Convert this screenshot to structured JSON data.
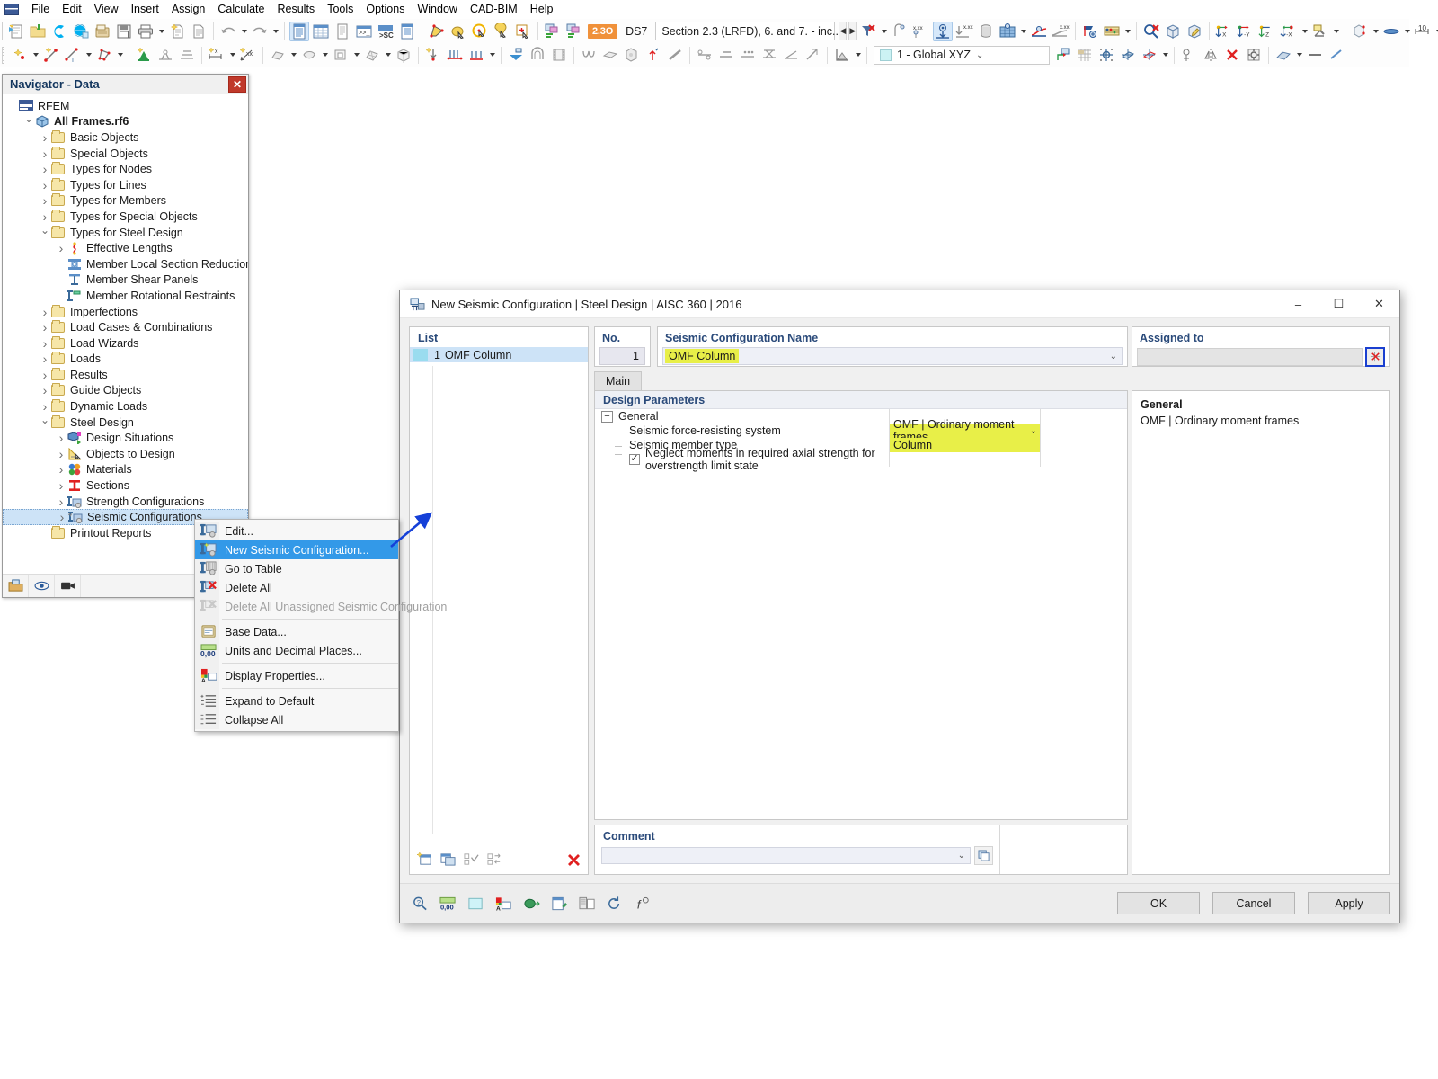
{
  "app": {
    "name": "RFEM",
    "logo_icon": "rfem-logo-icon"
  },
  "menubar": {
    "items": [
      "File",
      "Edit",
      "View",
      "Insert",
      "Assign",
      "Calculate",
      "Results",
      "Tools",
      "Options",
      "Window",
      "CAD-BIM",
      "Help"
    ]
  },
  "toolbar_top": {
    "badge": "2.3O",
    "ds_label": "DS7",
    "section_combo": "Section 2.3 (LRFD), 6. and 7. - inc...",
    "icons_group1": [
      "new-model-icon",
      "open-folder-icon",
      "connect-icon",
      "globe-icon",
      "save-as-icon",
      "save-icon",
      "print-icon",
      "new-report-icon",
      "document-icon"
    ],
    "icons_group2": [
      "undo-icon",
      "redo-icon"
    ],
    "icons_group3": [
      "table-list-icon",
      "table-grid-icon",
      "table-report-icon",
      "console-icon",
      "script-sc-icon",
      "table-blue-icon"
    ],
    "icons_group4": [
      "select-area-icon",
      "select-lasso-icon",
      "select-circle-icon",
      "select-pointer-icon",
      "select-plus-icon"
    ],
    "icons_group5": [
      "render-a-icon",
      "render-b-icon"
    ],
    "icons_group6": [
      "filter-clear-icon",
      "node-support-icon",
      "node-values-icon",
      "show-loads-icon",
      "hide-loads-icon",
      "solid-icon",
      "surface-icon",
      "deformation-icon",
      "diagram-icon",
      "result-flag-icon",
      "abacus-icon"
    ],
    "icons_group7": [
      "zoom-clear-icon",
      "cube-icon",
      "edit-cube-icon"
    ],
    "icons_group8": [
      "view-x-icon",
      "view-y-icon",
      "view-z-icon",
      "view-negx-icon",
      "perspective-icon"
    ],
    "icons_group9": [
      "box-view-icon",
      "lens-icon",
      "dim-10-icon",
      "layers-icon",
      "mesh-points-icon"
    ]
  },
  "toolbar_second": {
    "coord_system": "1 - Global XYZ",
    "icons_group1": [
      "new-node-icon",
      "new-line-icon",
      "new-line-i-icon",
      "new-polygon-icon"
    ],
    "icons_group2": [
      "new-support-icon",
      "new-hinge-icon",
      "new-release-icon"
    ],
    "icons_group3": [
      "dim-x-icon",
      "dim-xx-icon"
    ],
    "icons_group4": [
      "new-surface-icon",
      "new-solid-icon",
      "new-opening-icon",
      "new-mesh-icon",
      "new-block-icon"
    ],
    "icons_group5": [
      "new-load-icon",
      "member-load-icon",
      "line-load-icon",
      "surface-load-icon"
    ],
    "icons_group6": [
      "free-load-icon",
      "tunnel-icon",
      "film-icon"
    ],
    "icons_group7": [
      "curve-icon",
      "plate-icon",
      "box-load-icon",
      "arrow-up-icon",
      "slope-icon"
    ],
    "icons_group8": [
      "hinge-a-icon",
      "hinge-b-icon",
      "hinge-c-icon",
      "hinge-d-icon",
      "hinge-e-icon",
      "hinge-f-icon"
    ],
    "icons_group9": [
      "chart-icon"
    ],
    "icons_group10": [
      "ucs-icon",
      "grid-icon",
      "snap-icon",
      "plane-icon",
      "plane-2-icon"
    ],
    "icons_group11": [
      "guide-icon",
      "mirror-icon",
      "delete-red-icon",
      "settings-icon"
    ],
    "icons_group12": [
      "render-mode-icon",
      "line-style-icon",
      "dash-icon"
    ]
  },
  "navigator": {
    "title": "Navigator - Data",
    "close_icon": "close-icon",
    "tree": [
      {
        "label": "RFEM",
        "indent": 0,
        "chevron": "none",
        "icon": "rfem-logo-icon",
        "bold": false
      },
      {
        "label": "All Frames.rf6",
        "indent": 1,
        "chevron": "down",
        "icon": "model-icon",
        "bold": true
      },
      {
        "label": "Basic Objects",
        "indent": 2,
        "chevron": "right",
        "icon": "folder-icon",
        "bold": false
      },
      {
        "label": "Special Objects",
        "indent": 2,
        "chevron": "right",
        "icon": "folder-icon",
        "bold": false
      },
      {
        "label": "Types for Nodes",
        "indent": 2,
        "chevron": "right",
        "icon": "folder-icon",
        "bold": false
      },
      {
        "label": "Types for Lines",
        "indent": 2,
        "chevron": "right",
        "icon": "folder-icon",
        "bold": false
      },
      {
        "label": "Types for Members",
        "indent": 2,
        "chevron": "right",
        "icon": "folder-icon",
        "bold": false
      },
      {
        "label": "Types for Special Objects",
        "indent": 2,
        "chevron": "right",
        "icon": "folder-icon",
        "bold": false
      },
      {
        "label": "Types for Steel Design",
        "indent": 2,
        "chevron": "down",
        "icon": "folder-icon",
        "bold": false
      },
      {
        "label": "Effective Lengths",
        "indent": 3,
        "chevron": "right",
        "icon": "effective-lengths-icon",
        "bold": false
      },
      {
        "label": "Member Local Section Reductions",
        "indent": 3,
        "chevron": "none",
        "icon": "section-reduction-icon",
        "bold": false
      },
      {
        "label": "Member Shear Panels",
        "indent": 3,
        "chevron": "none",
        "icon": "shear-panel-icon",
        "bold": false
      },
      {
        "label": "Member Rotational Restraints",
        "indent": 3,
        "chevron": "none",
        "icon": "rotational-restraint-icon",
        "bold": false
      },
      {
        "label": "Imperfections",
        "indent": 2,
        "chevron": "right",
        "icon": "folder-icon",
        "bold": false
      },
      {
        "label": "Load Cases & Combinations",
        "indent": 2,
        "chevron": "right",
        "icon": "folder-icon",
        "bold": false
      },
      {
        "label": "Load Wizards",
        "indent": 2,
        "chevron": "right",
        "icon": "folder-icon",
        "bold": false
      },
      {
        "label": "Loads",
        "indent": 2,
        "chevron": "right",
        "icon": "folder-icon",
        "bold": false
      },
      {
        "label": "Results",
        "indent": 2,
        "chevron": "right",
        "icon": "folder-icon",
        "bold": false
      },
      {
        "label": "Guide Objects",
        "indent": 2,
        "chevron": "right",
        "icon": "folder-icon",
        "bold": false
      },
      {
        "label": "Dynamic Loads",
        "indent": 2,
        "chevron": "right",
        "icon": "folder-icon",
        "bold": false
      },
      {
        "label": "Steel Design",
        "indent": 2,
        "chevron": "down",
        "icon": "folder-icon",
        "bold": false
      },
      {
        "label": "Design Situations",
        "indent": 3,
        "chevron": "right",
        "icon": "design-situations-icon",
        "bold": false
      },
      {
        "label": "Objects to Design",
        "indent": 3,
        "chevron": "right",
        "icon": "objects-to-design-icon",
        "bold": false
      },
      {
        "label": "Materials",
        "indent": 3,
        "chevron": "right",
        "icon": "materials-icon",
        "bold": false
      },
      {
        "label": "Sections",
        "indent": 3,
        "chevron": "right",
        "icon": "sections-icon",
        "bold": false
      },
      {
        "label": "Strength Configurations",
        "indent": 3,
        "chevron": "right",
        "icon": "strength-config-icon",
        "bold": false
      },
      {
        "label": "Seismic Configurations",
        "indent": 3,
        "chevron": "right",
        "icon": "seismic-config-icon",
        "bold": false,
        "selected": true
      },
      {
        "label": "Printout Reports",
        "indent": 2,
        "chevron": "none",
        "icon": "folder-icon",
        "bold": false
      }
    ],
    "bottom_icons": [
      "open-navigator-icon",
      "visibility-eye-icon",
      "camera-icon"
    ]
  },
  "context_menu": {
    "items": [
      {
        "label": "Edit...",
        "icon": "edit-config-icon",
        "state": "normal"
      },
      {
        "label": "New Seismic Configuration...",
        "icon": "new-config-icon",
        "state": "selected"
      },
      {
        "label": "Go to Table",
        "icon": "goto-table-icon",
        "state": "normal"
      },
      {
        "label": "Delete All",
        "icon": "delete-all-icon",
        "state": "normal"
      },
      {
        "label": "Delete All Unassigned Seismic Configuration",
        "icon": "delete-unassigned-icon",
        "state": "disabled"
      },
      {
        "label": "Base Data...",
        "icon": "base-data-icon",
        "state": "normal",
        "sep_before": true
      },
      {
        "label": "Units and Decimal Places...",
        "icon": "units-decimal-icon",
        "state": "normal"
      },
      {
        "label": "Display Properties...",
        "icon": "display-properties-icon",
        "state": "normal",
        "sep_before": true
      },
      {
        "label": "Expand to Default",
        "icon": "expand-default-icon",
        "state": "normal",
        "sep_before": true
      },
      {
        "label": "Collapse All",
        "icon": "collapse-all-icon",
        "state": "normal"
      }
    ]
  },
  "dialog": {
    "title": "New Seismic Configuration | Steel Design | AISC 360 | 2016",
    "title_icon": "seismic-config-icon",
    "window_buttons": {
      "minimize": "–",
      "maximize": "☐",
      "close": "✕"
    },
    "list": {
      "header": "List",
      "items": [
        {
          "no": "1",
          "name": "OMF Column",
          "selected": true
        }
      ],
      "toolbar_icons": [
        "new-item-icon",
        "copy-item-icon",
        "check-all-icon",
        "invert-selection-icon",
        "delete-item-icon"
      ]
    },
    "no": {
      "header": "No.",
      "value": "1"
    },
    "name": {
      "header": "Seismic Configuration Name",
      "value": "OMF Column",
      "dropdown_icon": "chevron-down-icon"
    },
    "assigned": {
      "header": "Assigned to",
      "value": "",
      "button_icon": "select-objects-icon"
    },
    "tabs": [
      {
        "label": "Main",
        "active": true
      }
    ],
    "design_parameters": {
      "header": "Design Parameters",
      "group": {
        "label": "General",
        "expander": "−"
      },
      "rows": [
        {
          "type": "value",
          "label": "Seismic force-resisting system",
          "value": "OMF | Ordinary moment frames",
          "highlight": true,
          "dropdown": true
        },
        {
          "type": "value",
          "label": "Seismic member type",
          "value": "Column",
          "highlight": true,
          "dropdown": false
        },
        {
          "type": "checkbox",
          "label": "Neglect moments in required axial strength for overstrength limit state",
          "checked": true
        }
      ]
    },
    "comment": {
      "header": "Comment",
      "value": "",
      "dropdown_icon": "chevron-down-icon",
      "button_icon": "copy-comment-icon"
    },
    "info": {
      "header": "General",
      "text": "OMF | Ordinary moment frames"
    },
    "footer": {
      "tool_icons": [
        "help-search-icon",
        "units-0-00-icon",
        "color-swatch-icon",
        "display-props-icon",
        "model-link-icon",
        "export-icon",
        "copy-stack-icon",
        "reset-icon",
        "formula-icon"
      ],
      "buttons": [
        {
          "label": "OK"
        },
        {
          "label": "Cancel"
        },
        {
          "label": "Apply"
        }
      ]
    }
  },
  "colors": {
    "highlight_yellow": "#e8ef48",
    "selection_blue": "#3399e8",
    "header_blue": "#2a4a7a",
    "accent_orange": "#f0913a",
    "close_red": "#c0392b"
  }
}
